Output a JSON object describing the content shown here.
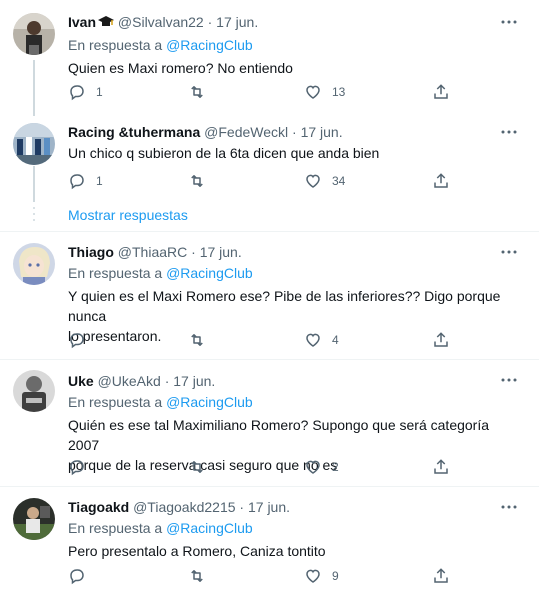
{
  "tweets": [
    {
      "name": "Ivan",
      "badge": "graduation-cap-emoji",
      "handle": "@Silvalvan22",
      "date": "17 jun.",
      "reply_prefix": "En respuesta a",
      "reply_to": "@RacingClub",
      "text": "Quien es Maxi romero? No entiendo",
      "replies": "1",
      "retweets": "",
      "likes": "13"
    },
    {
      "name": "Racing &tuhermana",
      "handle": "@FedeWeckl",
      "date": "17 jun.",
      "text": "Un chico q subieron de la 6ta dicen que anda bien",
      "replies": "1",
      "retweets": "",
      "likes": "34"
    },
    {
      "name": "Thiago",
      "handle": "@ThiaaRC",
      "date": "17 jun.",
      "reply_prefix": "En respuesta a",
      "reply_to": "@RacingClub",
      "text_lines": [
        "Y quien es el Maxi Romero ese? Pibe de las inferiores?? Digo porque nunca",
        "lo presentaron."
      ],
      "replies": "",
      "retweets": "",
      "likes": "4"
    },
    {
      "name": "Uke",
      "handle": "@UkeAkd",
      "date": "17 jun.",
      "reply_prefix": "En respuesta a",
      "reply_to": "@RacingClub",
      "text_lines": [
        "Quién es ese tal Maximiliano Romero? Supongo que será categoría 2007",
        "porque de la reserva casi seguro que no es"
      ],
      "replies": "",
      "retweets": "",
      "likes": "2"
    },
    {
      "name": "Tiagoakd",
      "handle": "@Tiagoakd2215",
      "date": "17 jun.",
      "reply_prefix": "En respuesta a",
      "reply_to": "@RacingClub",
      "text": "Pero presentalo a Romero, Caniza tontito",
      "replies": "",
      "retweets": "",
      "likes": "9"
    }
  ],
  "show_replies_label": "Mostrar respuestas",
  "dot": "·",
  "icons": {
    "reply": "reply-icon",
    "retweet": "retweet-icon",
    "like": "heart-icon",
    "share": "share-icon",
    "more": "more-icon"
  },
  "colors": {
    "link": "#1d9bf0",
    "secondary": "#536471",
    "divider": "#eff3f4",
    "thread": "#cfd9de"
  }
}
